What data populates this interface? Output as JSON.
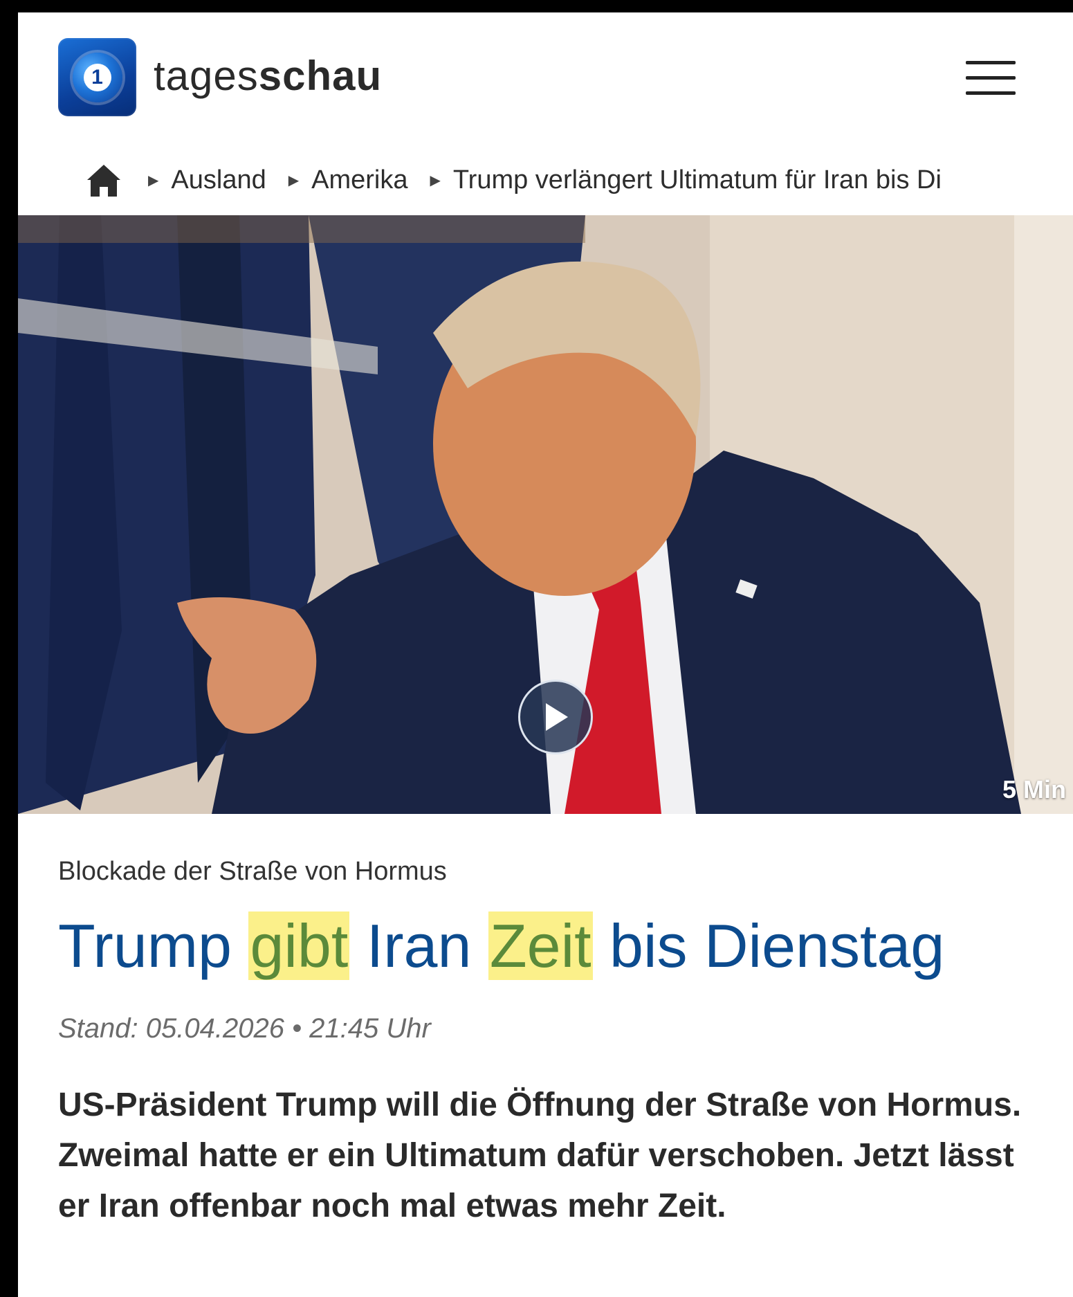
{
  "header": {
    "brand_light": "tages",
    "brand_bold": "schau",
    "logo_icon": "tagesschau-logo-icon",
    "menu_icon": "hamburger-menu-icon"
  },
  "breadcrumb": {
    "home_icon": "home-icon",
    "items": [
      {
        "label": "Ausland"
      },
      {
        "label": "Amerika"
      },
      {
        "label": "Trump verlängert Ultimatum für Iran bis Di"
      }
    ]
  },
  "hero": {
    "play_icon": "play-icon",
    "duration": "5 Min"
  },
  "article": {
    "topline": "Blockade der Straße von Hormus",
    "headline": {
      "w1": "Trump",
      "w2": "gibt",
      "w3": "Iran",
      "w4": "Zeit",
      "w5": "bis Dienstag"
    },
    "dateline": "Stand: 05.04.2026 • 21:45 Uhr",
    "lead": "US-Präsident Trump will die Öffnung der Straße von Hormus. Zweimal hatte er ein Ultimatum dafür verschoben. Jetzt lässt er Iran offenbar noch mal etwas mehr Zeit."
  },
  "colors": {
    "headline": "#0c4b8e",
    "highlight": "#fbf08a",
    "highlight_text": "#5b8a3a"
  }
}
